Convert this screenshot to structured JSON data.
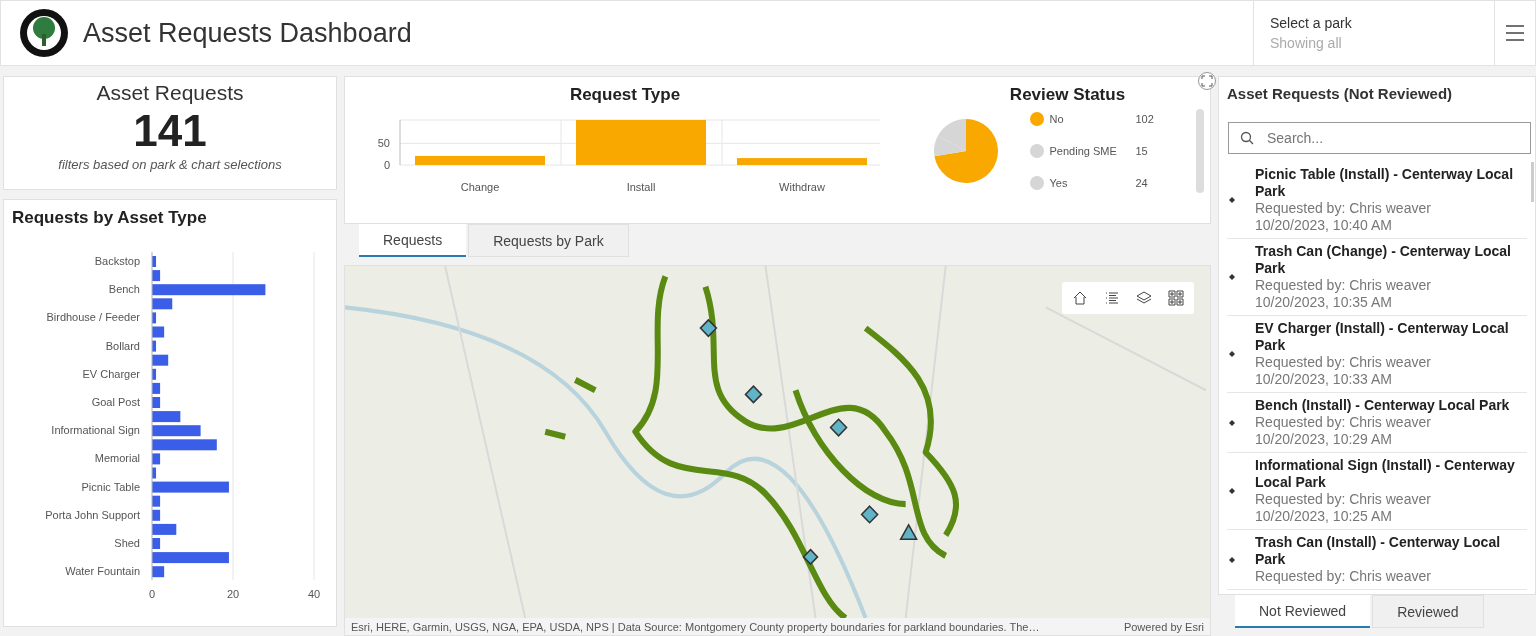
{
  "header": {
    "title": "Asset Requests Dashboard",
    "park_filter": {
      "label": "Select a park",
      "value": "Showing all"
    }
  },
  "summary": {
    "title": "Asset Requests",
    "count": "141",
    "note": "filters based on park & chart selections"
  },
  "asset_type": {
    "title": "Requests by Asset Type",
    "chart_data": {
      "type": "bar",
      "orientation": "horizontal",
      "categories": [
        "Backstop",
        null,
        "Bench",
        null,
        "Birdhouse / Feeder",
        null,
        "Bollard",
        null,
        "EV Charger",
        null,
        "Goal Post",
        null,
        "Informational Sign",
        null,
        "Memorial",
        null,
        "Picnic Table",
        null,
        "Porta John Support",
        null,
        "Shed",
        null,
        "Water Fountain"
      ],
      "values": [
        1,
        2,
        28,
        5,
        1,
        3,
        1,
        4,
        1,
        2,
        2,
        7,
        12,
        16,
        2,
        1,
        19,
        2,
        2,
        6,
        2,
        19,
        3
      ],
      "xlim": [
        0,
        40
      ],
      "xticks": [
        0,
        20,
        40
      ]
    }
  },
  "request_type": {
    "title": "Request Type",
    "chart_data": {
      "type": "bar",
      "categories": [
        "Change",
        "Install",
        "Withdraw"
      ],
      "values": [
        21,
        104,
        16
      ],
      "ylim": [
        0,
        104
      ],
      "yticks": [
        0,
        50
      ]
    }
  },
  "review_status": {
    "title": "Review Status",
    "chart_data": {
      "type": "pie",
      "categories": [
        "No",
        "Pending SME",
        "Yes"
      ]
    },
    "legend": [
      {
        "count": "102",
        "color": "#f9a800"
      },
      {
        "count": "15",
        "color": "#d6d6d6"
      },
      {
        "count": "24",
        "color": "#d6d6d6"
      }
    ]
  },
  "map_tabs": [
    {
      "label": "Requests",
      "selected": true
    },
    {
      "label": "Requests by Park",
      "selected": false
    }
  ],
  "map": {
    "attribution": "Esri, HERE, Garmin, USGS, NGA, EPA, USDA, NPS | Data Source: Montgomery County property boundaries for parkland boundaries. The…",
    "powered_by": "Powered by Esri"
  },
  "list_panel": {
    "title": "Asset Requests (Not Reviewed)",
    "search_placeholder": "Search...",
    "items": [
      {
        "title": "Picnic Table (Install) - Centerway Local Park",
        "requester": "Requested by: Chris weaver",
        "date": "10/20/2023, 10:40 AM"
      },
      {
        "title": "Trash Can (Change) - Centerway Local Park",
        "requester": "Requested by: Chris weaver",
        "date": "10/20/2023, 10:35 AM"
      },
      {
        "title": "EV Charger (Install) - Centerway Local Park",
        "requester": "Requested by: Chris weaver",
        "date": "10/20/2023, 10:33 AM"
      },
      {
        "title": "Bench (Install) - Centerway Local Park",
        "requester": "Requested by: Chris weaver",
        "date": "10/20/2023, 10:29 AM"
      },
      {
        "title": "Informational Sign (Install) - Centerway Local Park",
        "requester": "Requested by: Chris weaver",
        "date": "10/20/2023, 10:25 AM"
      },
      {
        "title": "Trash Can (Install) - Centerway Local Park",
        "requester": "Requested by: Chris weaver"
      }
    ],
    "tabs": [
      {
        "label": "Not Reviewed",
        "selected": true
      },
      {
        "label": "Reviewed",
        "selected": false
      }
    ]
  }
}
